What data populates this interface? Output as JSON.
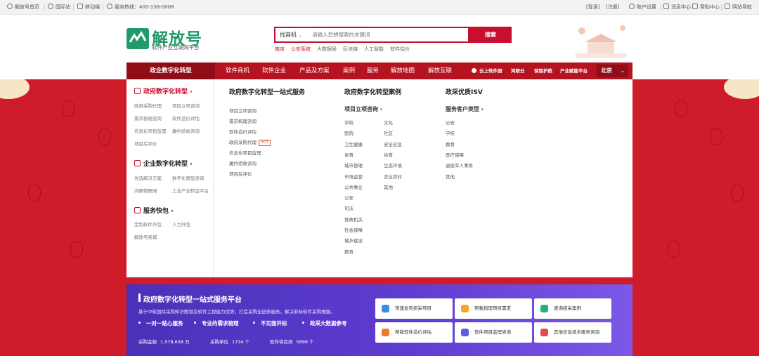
{
  "topbar": {
    "left": [
      "解放号首页",
      "国际站",
      "移动端",
      "服务热线：400-138-0008"
    ],
    "login": "[登录]",
    "register": "[注册]",
    "right": [
      "账户设置",
      "消息中心",
      "帮助中心",
      "网站导航"
    ]
  },
  "brand": {
    "logo_text": "解放号",
    "slogan": "软件产业互联网平台",
    "brand_color": "#1f9a6a"
  },
  "search": {
    "category": "找商机",
    "placeholder": "请输入您想搜索的关键词",
    "button": "搜索",
    "hotwords": [
      "南京",
      "公安系统",
      "大数据局",
      "区块链",
      "人工智能",
      "软件估价"
    ]
  },
  "nav": {
    "active": "政企数字化转型",
    "items": [
      "软件商机",
      "软件企业",
      "产品及方案",
      "案例",
      "服务",
      "解放地图",
      "解放互联"
    ],
    "specials": [
      "云上软件园",
      "鸿联云",
      "保智护航",
      "产业赋能平台"
    ],
    "city": "北京",
    "accent": "#c8102e"
  },
  "sidebar": {
    "gov": {
      "title": "政府数字化转型",
      "links": [
        "政府采购代理",
        "项目立项咨询",
        "需求梳理咨询",
        "软件造价评估",
        "信息化项目监理",
        "履约验收咨询",
        "项目后评价"
      ]
    },
    "ent": {
      "title": "企业数字化转型",
      "links": [
        "优选解决方案",
        "数字化转型咨询",
        "鸿联物联网",
        "工业产业转型平台"
      ]
    },
    "svc": {
      "title": "服务快包",
      "links": [
        "定制软件外包",
        "人力外包",
        "解放号商城"
      ]
    }
  },
  "col1": {
    "title": "政府数字化转型一站式服务",
    "links": [
      "项目立项咨询",
      "需求梳理咨询",
      "软件造价评估",
      "政府采购代理",
      "信息化项目监理",
      "履约验收咨询",
      "项目后评价"
    ],
    "hot": "HOT"
  },
  "col2": {
    "title": "政府数字化转型案例",
    "subtitle": "项目立项咨询",
    "left": [
      "学校",
      "医院",
      "卫生健康",
      "体育",
      "城市管理",
      "市场监管",
      "公共事业",
      "公安",
      "司法",
      "党政机关",
      "社会保障",
      "城乡建设",
      "教育"
    ],
    "right": [
      "文化",
      "社区",
      "安全应急",
      "体育",
      "生态环境",
      "农业农村",
      "其他"
    ]
  },
  "col3": {
    "title": "政采优质ISV",
    "subtitle": "服务客户类型",
    "links": [
      "公安",
      "学校",
      "教育",
      "医疗保障",
      "退役军人事务",
      "其他"
    ]
  },
  "promo": {
    "title": "政府数字化转型一站式服务平台",
    "desc": "基于中软国际采购知识图谱及软件工程能力优势，打造采购全链条服务，解决非标软件采购难题。",
    "features": [
      "一对一贴心服务",
      "专业的需求梳理",
      "不见面开标",
      "政采大数据参考"
    ],
    "stats": [
      {
        "label": "采购金额",
        "value": "1,578,638 万"
      },
      {
        "label": "采购单位",
        "value": "1734 个"
      },
      {
        "label": "软件供应商",
        "value": "5896 个"
      }
    ],
    "cards": [
      {
        "label": "快速发布招采项目",
        "icon": "paper-plane-icon",
        "color": "#3a8ee6"
      },
      {
        "label": "帮我梳理项目需求",
        "icon": "briefcase-icon",
        "color": "#f5a623"
      },
      {
        "label": "查询招采案例",
        "icon": "search-icon",
        "color": "#23b07d"
      },
      {
        "label": "帮我软件造价评估",
        "icon": "calculator-icon",
        "color": "#f07b26"
      },
      {
        "label": "软件项目监理咨询",
        "icon": "monitor-icon",
        "color": "#5b5fe0"
      },
      {
        "label": "其他信息技术服务咨询",
        "icon": "cluster-icon",
        "color": "#e5484d"
      }
    ]
  }
}
